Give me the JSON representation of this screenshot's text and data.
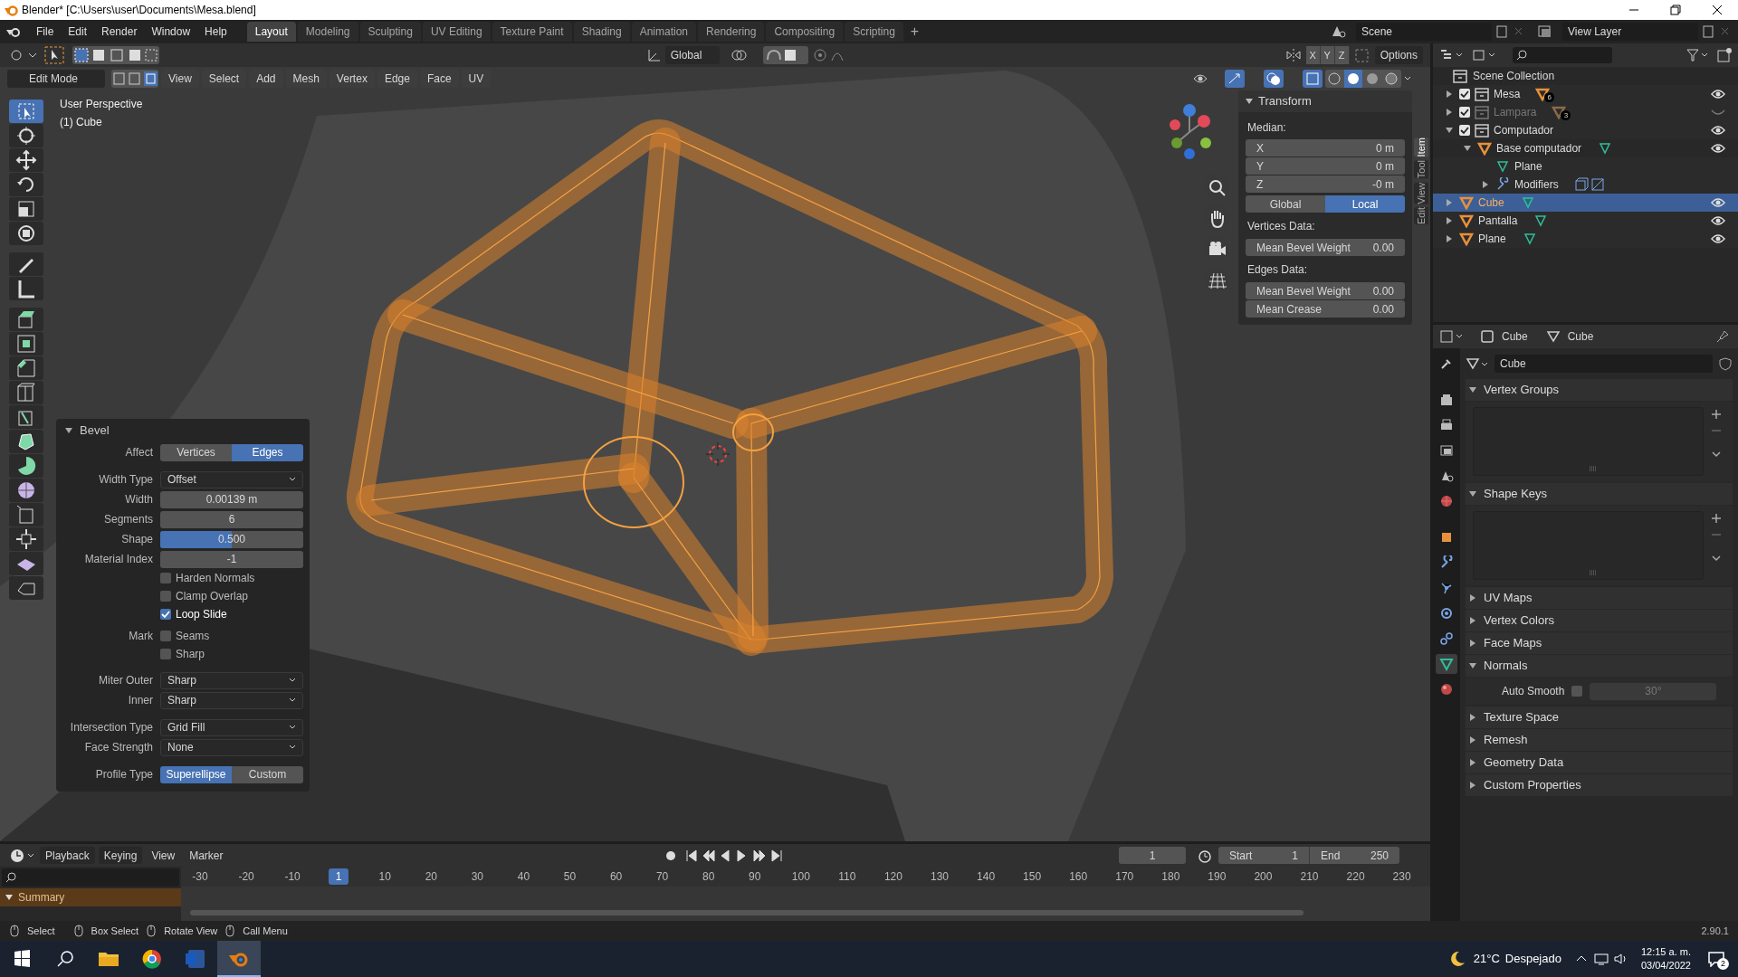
{
  "window": {
    "title": "Blender* [C:\\Users\\user\\Documents\\Mesa.blend]"
  },
  "menu": [
    "File",
    "Edit",
    "Render",
    "Window",
    "Help"
  ],
  "workspaces": [
    {
      "label": "Layout",
      "selected": true
    },
    {
      "label": "Modeling",
      "selected": false
    },
    {
      "label": "Sculpting",
      "selected": false
    },
    {
      "label": "UV Editing",
      "selected": false
    },
    {
      "label": "Texture Paint",
      "selected": false
    },
    {
      "label": "Shading",
      "selected": false
    },
    {
      "label": "Animation",
      "selected": false
    },
    {
      "label": "Rendering",
      "selected": false
    },
    {
      "label": "Compositing",
      "selected": false
    },
    {
      "label": "Scripting",
      "selected": false
    }
  ],
  "add_workspace": "+",
  "scene": "Scene",
  "view_layer": "View Layer",
  "tool_header": {
    "orientation": "Global",
    "axes": [
      "X",
      "Y",
      "Z"
    ],
    "options": "Options"
  },
  "viewport_header": {
    "mode": "Edit Mode",
    "menus": [
      "View",
      "Select",
      "Add",
      "Mesh",
      "Vertex",
      "Edge",
      "Face",
      "UV"
    ]
  },
  "viewport": {
    "view_name": "User Perspective",
    "object_name": "(1) Cube"
  },
  "n_panel": {
    "tabs": [
      {
        "label": "Item",
        "selected": true
      },
      {
        "label": "Tool",
        "selected": false
      },
      {
        "label": "View",
        "selected": false
      },
      {
        "label": "Edit",
        "selected": false
      }
    ],
    "title": "Transform",
    "median_label": "Median:",
    "median": [
      {
        "axis": "X",
        "value": "0 m"
      },
      {
        "axis": "Y",
        "value": "0 m"
      },
      {
        "axis": "Z",
        "value": "-0 m"
      }
    ],
    "space": [
      {
        "label": "Global",
        "selected": false
      },
      {
        "label": "Local",
        "selected": true
      }
    ],
    "sections": [
      {
        "title": "Vertices Data:",
        "fields": [
          {
            "label": "Mean Bevel Weight",
            "value": "0.00"
          }
        ]
      },
      {
        "title": "Edges Data:",
        "fields": [
          {
            "label": "Mean Bevel Weight",
            "value": "0.00"
          },
          {
            "label": "Mean Crease",
            "value": "0.00"
          }
        ]
      }
    ]
  },
  "bevel_panel": {
    "title": "Bevel",
    "rows": [
      {
        "kind": "segmented",
        "label": "Affect",
        "options": [
          {
            "label": "Vertices",
            "selected": false
          },
          {
            "label": "Edges",
            "selected": true
          }
        ]
      },
      {
        "kind": "dropdown",
        "label": "Width Type",
        "value": "Offset"
      },
      {
        "kind": "number",
        "label": "Width",
        "value": "0.00139 m"
      },
      {
        "kind": "number",
        "label": "Segments",
        "value": "6"
      },
      {
        "kind": "slider",
        "label": "Shape",
        "value": "0.500",
        "level": 0.5
      },
      {
        "kind": "number",
        "label": "Material Index",
        "value": "-1"
      },
      {
        "kind": "checkbox",
        "text": "Harden Normals",
        "checked": false
      },
      {
        "kind": "checkbox",
        "text": "Clamp Overlap",
        "checked": false
      },
      {
        "kind": "checkbox",
        "text": "Loop Slide",
        "checked": true
      },
      {
        "kind": "checkbox",
        "label": "Mark",
        "text": "Seams",
        "checked": false
      },
      {
        "kind": "checkbox",
        "text": "Sharp",
        "checked": false
      },
      {
        "kind": "dropdown",
        "label": "Miter Outer",
        "value": "Sharp"
      },
      {
        "kind": "dropdown",
        "label": "Inner",
        "value": "Sharp"
      },
      {
        "kind": "dropdown",
        "label": "Intersection Type",
        "value": "Grid Fill"
      },
      {
        "kind": "dropdown",
        "label": "Face Strength",
        "value": "None"
      },
      {
        "kind": "segmented",
        "label": "Profile Type",
        "options": [
          {
            "label": "Superellipse",
            "selected": true
          },
          {
            "label": "Custom",
            "selected": false
          }
        ]
      }
    ]
  },
  "outliner": {
    "root": "Scene Collection",
    "items": [
      {
        "kind": "collection",
        "name": "Mesa",
        "checked": true,
        "visible": true,
        "expanded": false,
        "selected": false,
        "badge": "6"
      },
      {
        "kind": "collection",
        "name": "Lampara",
        "checked": true,
        "visible": false,
        "expanded": false,
        "selected": false,
        "badge": "3"
      },
      {
        "kind": "collection",
        "name": "Computador",
        "checked": true,
        "visible": true,
        "expanded": true,
        "selected": false,
        "children": [
          {
            "kind": "object",
            "name": "Base computador",
            "visible": true,
            "expanded": true,
            "selected": false,
            "children": [
              {
                "kind": "mesh",
                "name": "Plane",
                "selected": false
              },
              {
                "kind": "modifiers",
                "name": "Modifiers",
                "expanded": false,
                "selected": false
              }
            ]
          }
        ]
      },
      {
        "kind": "object",
        "name": "Cube",
        "visible": true,
        "expanded": false,
        "selected": true
      },
      {
        "kind": "object",
        "name": "Pantalla",
        "visible": true,
        "expanded": false,
        "selected": false
      },
      {
        "kind": "object",
        "name": "Plane",
        "visible": true,
        "expanded": false,
        "selected": false
      }
    ]
  },
  "properties": {
    "breadcrumb": [
      "Cube",
      "Cube"
    ],
    "data_name": "Cube",
    "panels": [
      {
        "kind": "list",
        "title": "Vertex Groups",
        "expanded": true
      },
      {
        "kind": "list",
        "title": "Shape Keys",
        "expanded": true
      },
      {
        "title": "UV Maps",
        "expanded": false
      },
      {
        "title": "Vertex Colors",
        "expanded": false
      },
      {
        "title": "Face Maps",
        "expanded": false
      },
      {
        "kind": "normals",
        "title": "Normals",
        "expanded": true,
        "auto_smooth": {
          "label": "Auto Smooth",
          "checked": false,
          "angle": "30°"
        }
      },
      {
        "title": "Texture Space",
        "expanded": false
      },
      {
        "title": "Remesh",
        "expanded": false
      },
      {
        "title": "Geometry Data",
        "expanded": false
      },
      {
        "title": "Custom Properties",
        "expanded": false
      }
    ]
  },
  "timeline": {
    "menus": [
      "Playback",
      "Keying",
      "View",
      "Marker"
    ],
    "current_frame": "1",
    "start_label": "Start",
    "start": "1",
    "end_label": "End",
    "end": "250",
    "channel": "Summary",
    "ruler": [
      {
        "label": "-30",
        "selected": false
      },
      {
        "label": "-20",
        "selected": false
      },
      {
        "label": "-10",
        "selected": false
      },
      {
        "label": "1",
        "selected": true
      },
      {
        "label": "10",
        "selected": false
      },
      {
        "label": "20",
        "selected": false
      },
      {
        "label": "30",
        "selected": false
      },
      {
        "label": "40",
        "selected": false
      },
      {
        "label": "50",
        "selected": false
      },
      {
        "label": "60",
        "selected": false
      },
      {
        "label": "70",
        "selected": false
      },
      {
        "label": "80",
        "selected": false
      },
      {
        "label": "90",
        "selected": false
      },
      {
        "label": "100",
        "selected": false
      },
      {
        "label": "110",
        "selected": false
      },
      {
        "label": "120",
        "selected": false
      },
      {
        "label": "130",
        "selected": false
      },
      {
        "label": "140",
        "selected": false
      },
      {
        "label": "150",
        "selected": false
      },
      {
        "label": "160",
        "selected": false
      },
      {
        "label": "170",
        "selected": false
      },
      {
        "label": "180",
        "selected": false
      },
      {
        "label": "190",
        "selected": false
      },
      {
        "label": "200",
        "selected": false
      },
      {
        "label": "210",
        "selected": false
      },
      {
        "label": "220",
        "selected": false
      },
      {
        "label": "230",
        "selected": false
      }
    ]
  },
  "status_bar": {
    "hints": [
      "Select",
      "Box Select",
      "Rotate View",
      "Call Menu"
    ],
    "version": "2.90.1"
  },
  "taskbar": {
    "temperature": "21°C",
    "weather": "Despejado",
    "time": "12:15 a. m.",
    "date": "03/04/2022",
    "notifications": "2"
  }
}
